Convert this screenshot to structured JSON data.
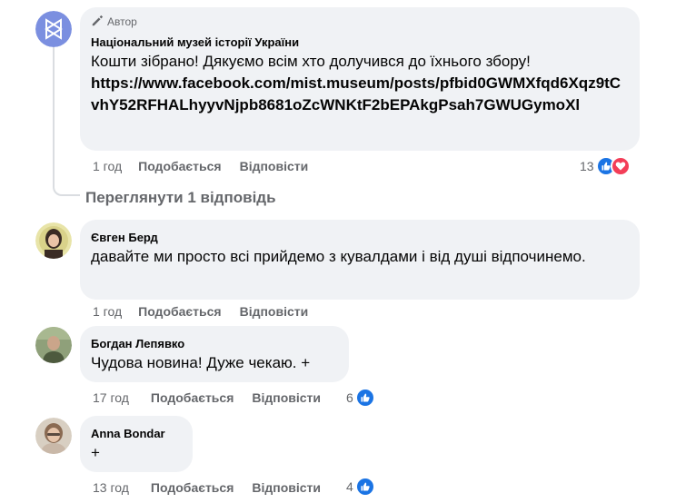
{
  "comments": [
    {
      "author_badge": "Автор",
      "author": "Національний музей історії України",
      "text": "Кошти зібрано! Дякуємо всім хто долучився до їхнього збору!",
      "link": "https://www.facebook.com/mist.museum/posts/pfbid0GWMXfqd6Xqz9tCvhY52RFHALhyyvNjpb8681oZcWNKtF2bEPAkgPsah7GWUGymoXl",
      "time": "1 год",
      "like_label": "Подобається",
      "reply_label": "Відповісти",
      "reaction_count": "13",
      "view_replies": "Переглянути 1 відповідь"
    },
    {
      "author": "Євген Берд",
      "text": "давайте ми просто всі прийдемо з кувалдами і від душі відпочинемо.",
      "time": "1 год",
      "like_label": "Подобається",
      "reply_label": "Відповісти"
    },
    {
      "author": "Богдан Лепявко",
      "text": "Чудова новина! Дуже чекаю. +",
      "time": "17 год",
      "like_label": "Подобається",
      "reply_label": "Відповісти",
      "reaction_count": "6"
    },
    {
      "author": "Anna Bondar",
      "text": "+",
      "time": "13 год",
      "like_label": "Подобається",
      "reply_label": "Відповісти",
      "reaction_count": "4"
    }
  ],
  "colors": {
    "bubble": "#f0f2f5",
    "secondary_text": "#65676b",
    "like_blue": "#1b74e4",
    "love_red": "#f33e58",
    "museum_avatar": "#7b8fe0"
  },
  "icons": {
    "author_badge": "pencil-icon",
    "like_reaction": "thumbs-up-icon",
    "love_reaction": "heart-icon"
  }
}
